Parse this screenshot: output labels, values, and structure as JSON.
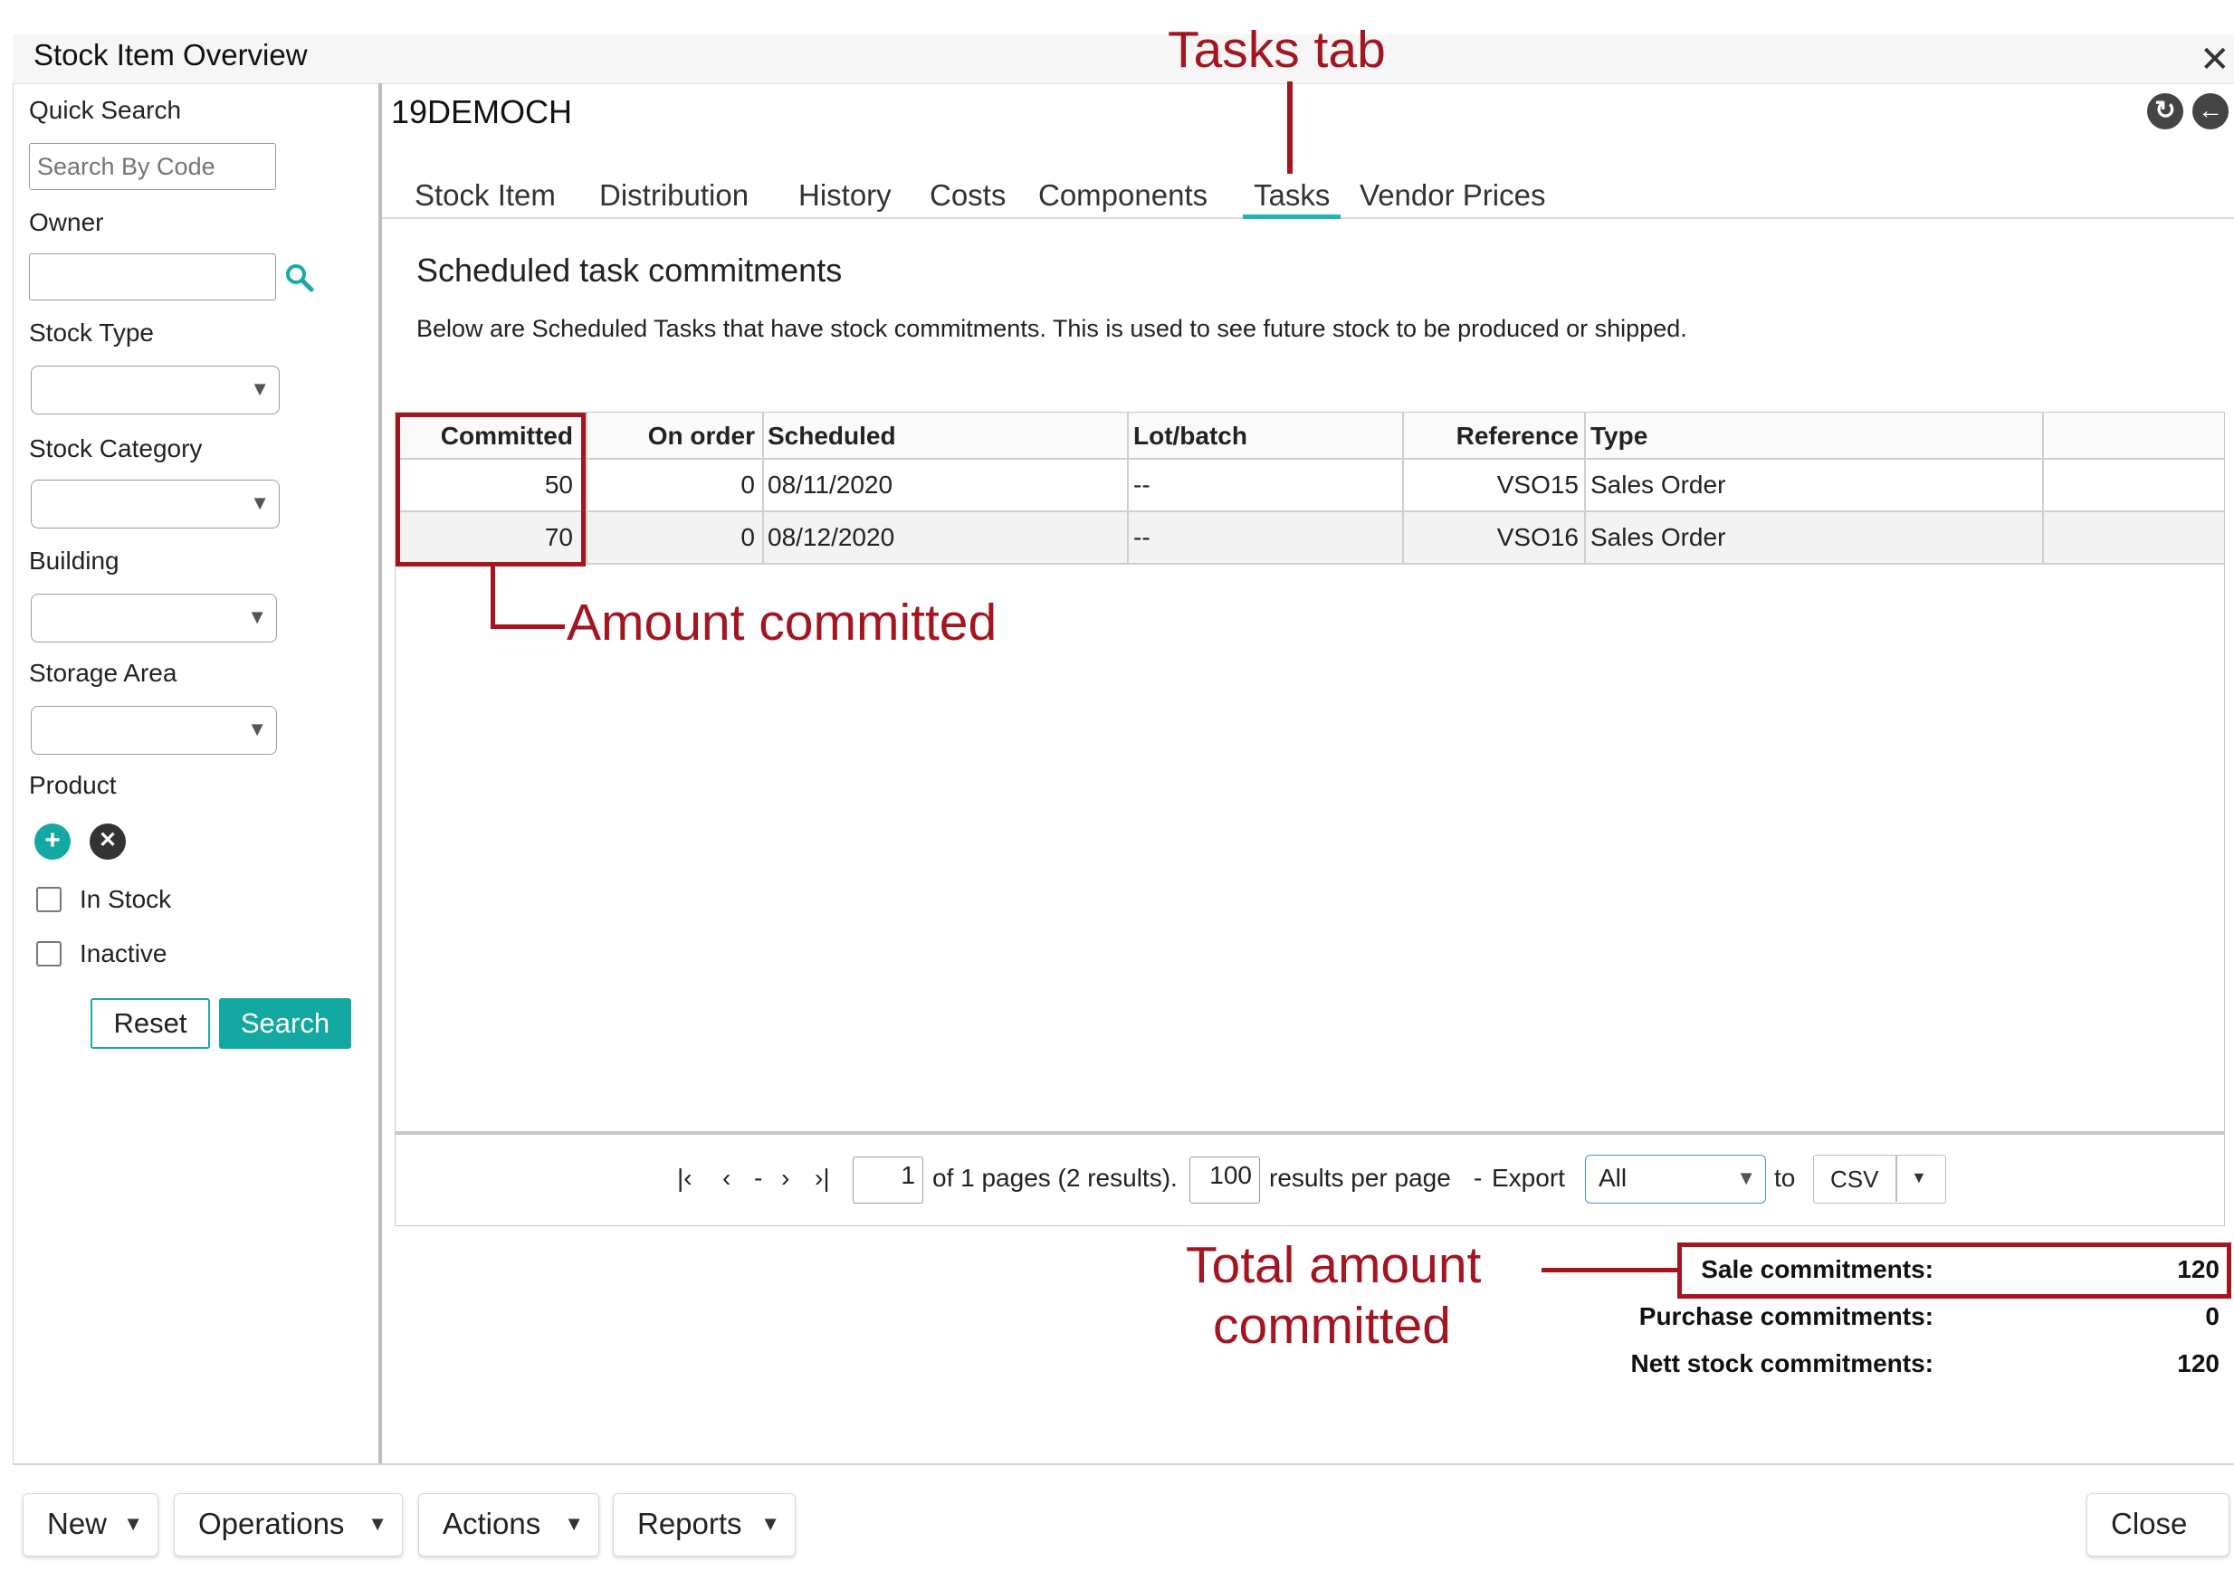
{
  "window": {
    "title": "Stock Item Overview",
    "close_glyph": "✕"
  },
  "sidebar": {
    "quick_search_label": "Quick Search",
    "search_placeholder": "Search By Code",
    "owner_label": "Owner",
    "owner_value": "",
    "stock_type_label": "Stock Type",
    "stock_category_label": "Stock Category",
    "building_label": "Building",
    "storage_area_label": "Storage Area",
    "product_label": "Product",
    "in_stock_label": "In Stock",
    "inactive_label": "Inactive",
    "reset_label": "Reset",
    "search_label": "Search",
    "icons": [
      "search-icon",
      "add-icon",
      "remove-icon",
      "chevron-down-icon"
    ]
  },
  "item": {
    "code": "19DEMOCH"
  },
  "tabs": [
    {
      "label": "Stock Item",
      "active": false
    },
    {
      "label": "Distribution",
      "active": false
    },
    {
      "label": "History",
      "active": false
    },
    {
      "label": "Costs",
      "active": false
    },
    {
      "label": "Components",
      "active": false
    },
    {
      "label": "Tasks",
      "active": true
    },
    {
      "label": "Vendor Prices",
      "active": false
    }
  ],
  "section": {
    "heading": "Scheduled task commitments",
    "description": "Below are Scheduled Tasks that have stock commitments. This is used to see future stock to be produced or shipped."
  },
  "table": {
    "headers": [
      "Committed",
      "On order",
      "Scheduled",
      "Lot/batch",
      "Reference",
      "Type",
      ""
    ],
    "rows": [
      [
        "50",
        "0",
        "08/11/2020",
        "--",
        "VSO15",
        "Sales Order",
        ""
      ],
      [
        "70",
        "0",
        "08/12/2020",
        "--",
        "VSO16",
        "Sales Order",
        ""
      ]
    ]
  },
  "pager": {
    "page_value": "1",
    "of_text": "of 1 pages (2 results).",
    "per_page_value": "100",
    "per_page_text": "results per page",
    "dash": "-",
    "export_label": "Export",
    "export_scope": "All",
    "to_label": "to",
    "format": "CSV",
    "nav_first": "|‹",
    "nav_prev": "‹",
    "nav_sep": "-",
    "nav_next": "›",
    "nav_last": "›|"
  },
  "summary": {
    "sale_label": "Sale commitments:",
    "sale_value": "120",
    "purchase_label": "Purchase commitments:",
    "purchase_value": "0",
    "nett_label": "Nett stock commitments:",
    "nett_value": "120"
  },
  "annotations": {
    "tasks_tab": "Tasks tab",
    "amount_committed": "Amount committed",
    "total_line1": "Total amount",
    "total_line2": "committed",
    "color": "#a31621"
  },
  "footer": {
    "new_label": "New",
    "operations_label": "Operations",
    "actions_label": "Actions",
    "reports_label": "Reports",
    "close_label": "Close"
  },
  "colors": {
    "accent": "#14a8a3",
    "annotation": "#a31621"
  }
}
